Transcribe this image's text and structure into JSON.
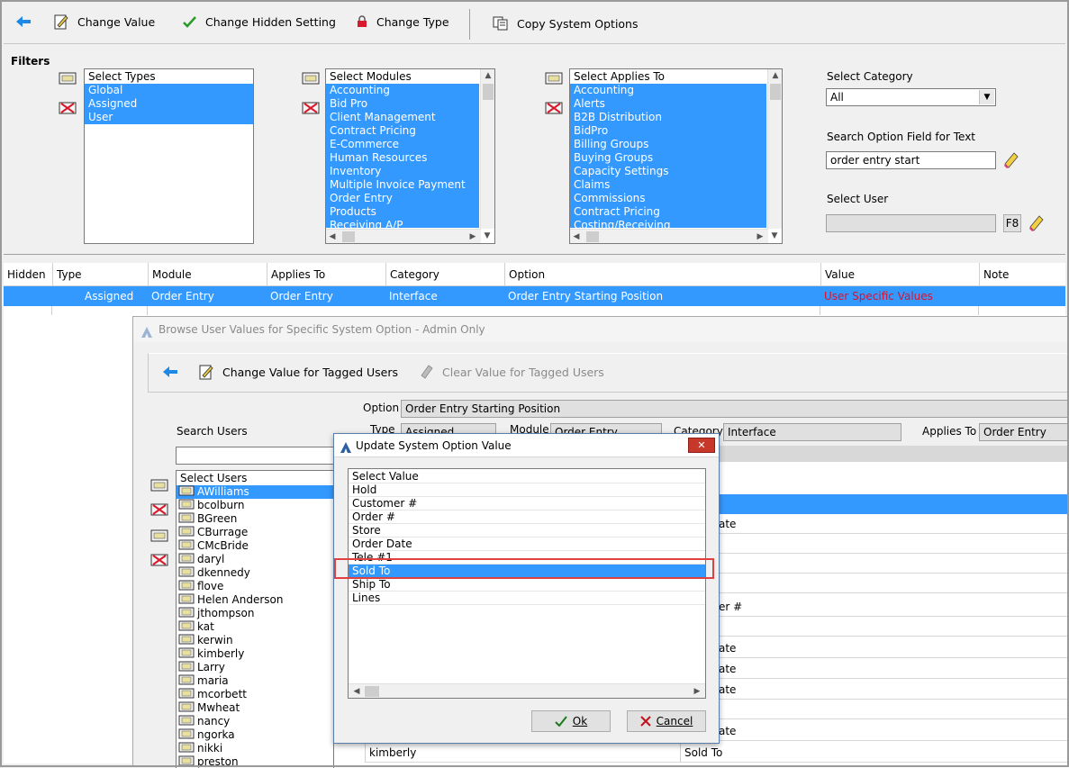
{
  "toolbar": {
    "change_value": "Change Value",
    "change_hidden": "Change Hidden Setting",
    "change_type": "Change Type",
    "copy_options": "Copy System Options"
  },
  "filters": {
    "title": "Filters",
    "types": {
      "header": "Select Types",
      "items": [
        "Global",
        "Assigned",
        "User"
      ]
    },
    "modules": {
      "header": "Select Modules",
      "items": [
        "Accounting",
        "Bid Pro",
        "Client Management",
        "Contract Pricing",
        "E-Commerce",
        "Human Resources",
        "Inventory",
        "Multiple Invoice Payment",
        "Order Entry",
        "Products",
        "Receiving A/P"
      ]
    },
    "applies": {
      "header": "Select Applies To",
      "items": [
        "Accounting",
        "Alerts",
        "B2B Distribution",
        "BidPro",
        "Billing Groups",
        "Buying Groups",
        "Capacity Settings",
        "Claims",
        "Commissions",
        "Contract Pricing",
        "Costing/Receiving"
      ]
    },
    "category_label": "Select Category",
    "category_value": "All",
    "search_label": "Search Option Field for Text",
    "search_value": "order entry start",
    "user_label": "Select User",
    "f8": "F8"
  },
  "grid": {
    "headers": [
      "Hidden",
      "Type",
      "Module",
      "Applies To",
      "Category",
      "Option",
      "Value",
      "Note"
    ],
    "row": {
      "type": "Assigned",
      "module": "Order Entry",
      "applies": "Order Entry",
      "category": "Interface",
      "option": "Order Entry Starting Position",
      "value": "User Specific Values"
    }
  },
  "browse": {
    "title": "Browse User Values for Specific System Option - Admin Only",
    "change_tagged": "Change Value for Tagged Users",
    "clear_tagged": "Clear Value for Tagged Users",
    "option_label": "Option",
    "option_value": "Order Entry Starting Position",
    "type_label": "Type",
    "type_value": "Assigned",
    "module_label": "Module",
    "module_value": "Order Entry",
    "category_label": "Category",
    "category_value": "Interface",
    "applies_label": "Applies To",
    "applies_value": "Order Entry",
    "search_users_label": "Search Users",
    "users_header": "Select Users",
    "users": [
      "AWilliams",
      "bcolburn",
      "BGreen",
      "CBurrage",
      "CMcBride",
      "daryl",
      "dkennedy",
      "flove",
      "Helen Anderson",
      "jthompson",
      "kat",
      "kerwin",
      "kimberly",
      "Larry",
      "maria",
      "mcorbett",
      "Mwheat",
      "nancy",
      "ngorka",
      "nikki",
      "preston"
    ],
    "bg_values": [
      "ate",
      "er #",
      "ate",
      "ate",
      "ate",
      "ate"
    ],
    "bottom_user": "kimberly",
    "bottom_value": "Sold To"
  },
  "dialog": {
    "title": "Update System Option Value",
    "header": "Select Value",
    "items": [
      "Hold",
      "Customer #",
      "Order #",
      "Store",
      "Order Date",
      "Tele #1",
      "Sold To",
      "Ship To",
      "Lines"
    ],
    "selected_index": 6,
    "ok": "Ok",
    "cancel": "Cancel"
  },
  "colors": {
    "selection": "#3399ff",
    "user_specific": "#e0102a",
    "highlight_box": "#e04040"
  }
}
